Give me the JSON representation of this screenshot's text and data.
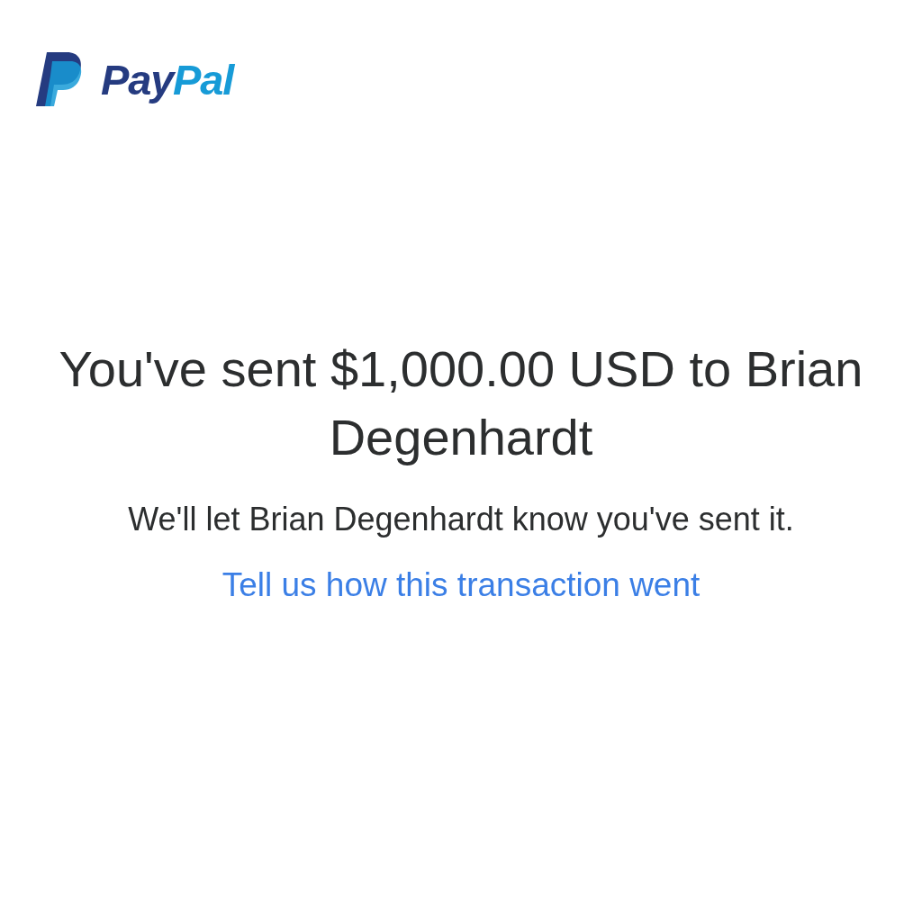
{
  "logo": {
    "parts": [
      {
        "text": "Pay",
        "color": "#253b80"
      },
      {
        "text": "Pal",
        "color": "#179bd7"
      }
    ]
  },
  "headline": "You've sent $1,000.00 USD to Brian Degenhardt",
  "message": "We'll let Brian Degenhardt know you've sent it.",
  "feedback_link": "Tell us how this transaction went"
}
